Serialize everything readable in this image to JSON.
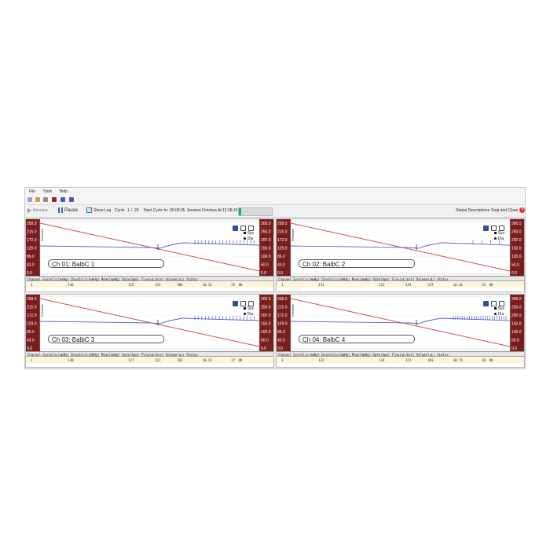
{
  "menu": [
    "File",
    "Tools",
    "Help"
  ],
  "toolbar": {
    "resume_label": "Resume",
    "pause_label": "Pause",
    "show_log_label": "Show Log",
    "cycle_label": "Cycle",
    "cycle_current": "1",
    "cycle_sep": "/",
    "cycle_total": "20",
    "next_cycle_label": "Next Cycle In:",
    "next_cycle_value": "00:00:05",
    "session_label": "Session Finishes At:",
    "session_value": "12:28:10",
    "progress": 0.06,
    "status_desc_label": "Status Descriptions",
    "stop_close_label": "Stop and Close"
  },
  "axes": {
    "left_ticks": [
      "258.0",
      "215.0",
      "172.0",
      "129.0",
      "86.0",
      "43.0",
      "0.0"
    ],
    "right_ticks": [
      "300.0",
      "250.0",
      "200.0",
      "150.0",
      "100.0",
      "50.0",
      "0.0"
    ],
    "left_label": "Pressure",
    "right_label": "Rate"
  },
  "legend": {
    "sys": "Sys",
    "dia": "Dia"
  },
  "table_header": "Channel Systolic(mmHg) Diastolic(mmHg) Mean(mmHg) Rate(bpm) Flow(uL/min) Volume(uL) Status",
  "colors": {
    "pressure_line": "#5563d6",
    "ramp_line": "#d84848",
    "axis_band": "#7a1d1d",
    "row_highlight": "#fbf6d8"
  },
  "channels": [
    {
      "name": "Ch 01: BalbC 1",
      "row": [
        "1",
        "136",
        "115",
        "124",
        "584",
        "10.32",
        "25",
        "OK"
      ]
    },
    {
      "name": "Ch 02: BalbC 2",
      "row": [
        "1",
        "131",
        "112",
        "119",
        "527",
        "10.44",
        "31",
        "OK"
      ]
    },
    {
      "name": "Ch 03: BalbC 3",
      "row": [
        "1",
        "130",
        "117",
        "121",
        "702",
        "10.23",
        "27",
        "OK"
      ]
    },
    {
      "name": "Ch 04: BalbC 4",
      "row": [
        "1",
        "132",
        "114",
        "121",
        "493",
        "10.15",
        "30",
        "OK"
      ]
    }
  ]
}
